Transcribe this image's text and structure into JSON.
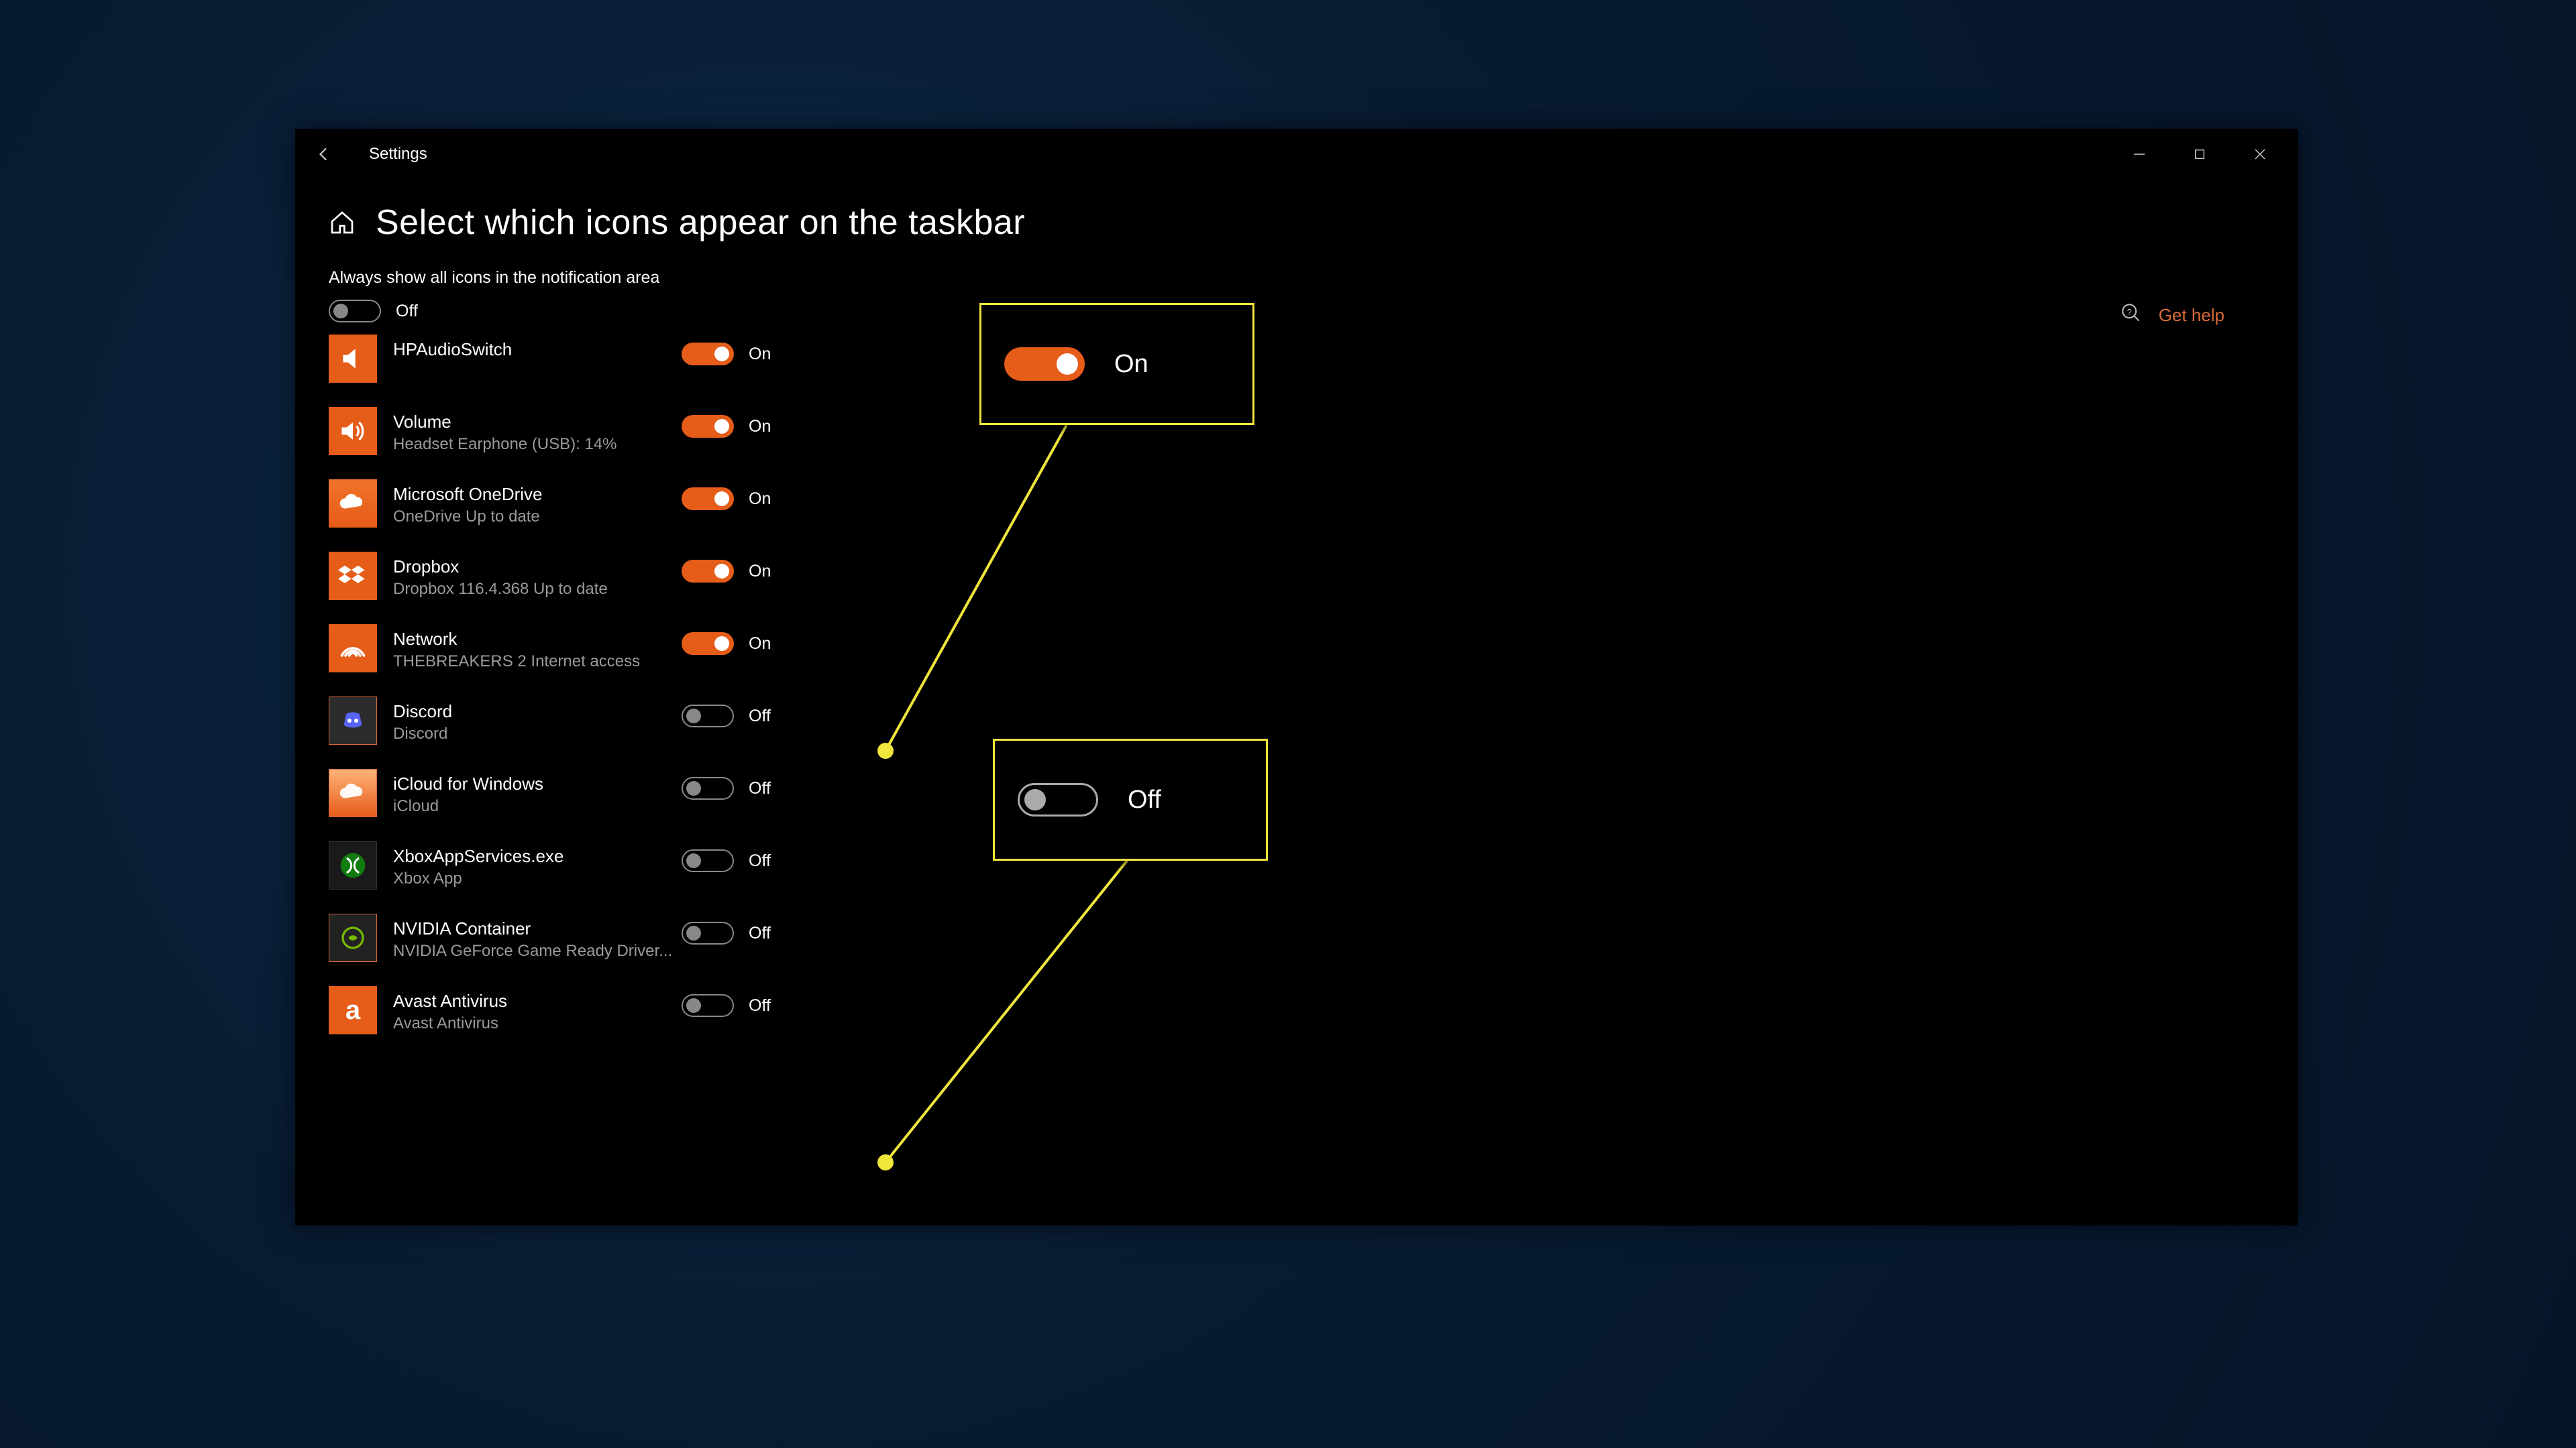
{
  "window": {
    "title": "Settings"
  },
  "page": {
    "heading": "Select which icons appear on the taskbar",
    "always_label": "Always show all icons in the notification area",
    "always_state_label": "Off",
    "on_word": "On",
    "off_word": "Off"
  },
  "items": [
    {
      "name": "HPAudioSwitch",
      "sub": "",
      "state": "on",
      "state_label": "On"
    },
    {
      "name": "Volume",
      "sub": "Headset Earphone (USB): 14%",
      "state": "on",
      "state_label": "On"
    },
    {
      "name": "Microsoft OneDrive",
      "sub": "OneDrive Up to date",
      "state": "on",
      "state_label": "On"
    },
    {
      "name": "Dropbox",
      "sub": "Dropbox 116.4.368 Up to date",
      "state": "on",
      "state_label": "On"
    },
    {
      "name": "Network",
      "sub": "THEBREAKERS 2 Internet access",
      "state": "on",
      "state_label": "On"
    },
    {
      "name": "Discord",
      "sub": "Discord",
      "state": "off",
      "state_label": "Off"
    },
    {
      "name": "iCloud for Windows",
      "sub": "iCloud",
      "state": "off",
      "state_label": "Off"
    },
    {
      "name": "XboxAppServices.exe",
      "sub": "Xbox App",
      "state": "off",
      "state_label": "Off"
    },
    {
      "name": "NVIDIA Container",
      "sub": "NVIDIA GeForce Game Ready Driver...",
      "state": "off",
      "state_label": "Off"
    },
    {
      "name": "Avast Antivirus",
      "sub": "Avast Antivirus",
      "state": "off",
      "state_label": "Off"
    }
  ],
  "side": {
    "help": "Get help"
  },
  "callouts": {
    "on_label": "On",
    "off_label": "Off"
  }
}
